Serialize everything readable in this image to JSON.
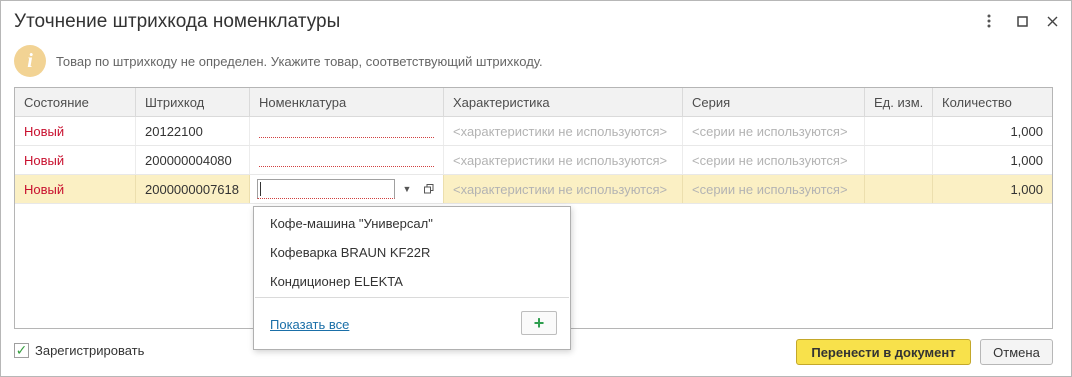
{
  "window": {
    "title": "Уточнение штрихкода номенклатуры"
  },
  "info": {
    "message": "Товар по штрихкоду не определен. Укажите товар, соответствующий штрихкоду."
  },
  "table": {
    "columns": [
      "Состояние",
      "Штрихкод",
      "Номенклатура",
      "Характеристика",
      "Серия",
      "Ед. изм.",
      "Количество"
    ],
    "rows": [
      {
        "state": "Новый",
        "barcode": "20122100",
        "nomenclature": "",
        "characteristic": "<характеристики не используются>",
        "series": "<серии не используются>",
        "unit": "",
        "quantity": "1,000"
      },
      {
        "state": "Новый",
        "barcode": "200000004080",
        "nomenclature": "",
        "characteristic": "<характеристики не используются>",
        "series": "<серии не используются>",
        "unit": "",
        "quantity": "1,000"
      },
      {
        "state": "Новый",
        "barcode": "2000000007618",
        "nomenclature": "",
        "characteristic": "<характеристики не используются>",
        "series": "<серии не используются>",
        "unit": "",
        "quantity": "1,000"
      }
    ]
  },
  "dropdown": {
    "items": [
      "Кофе-машина \"Универсал\"",
      "Кофеварка BRAUN KF22R",
      "Кондиционер ELEKTA"
    ],
    "show_all": "Показать все",
    "add_icon": "plus-icon"
  },
  "register_checkbox": {
    "label": "Зарегистрировать",
    "checked": true
  },
  "buttons": {
    "primary": "Перенести в документ",
    "cancel": "Отмена"
  },
  "colors": {
    "state_new": "#c8102e",
    "selected_row": "#fbf0c4",
    "primary_button": "#f8e14b",
    "link": "#1a6fa8",
    "info_icon": "#f2d394"
  }
}
